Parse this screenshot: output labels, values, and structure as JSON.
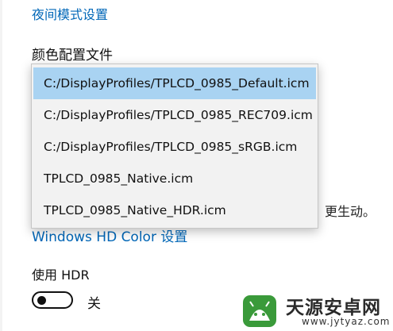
{
  "links": {
    "night_mode": "夜间模式设置",
    "hd_color": "Windows HD Color 设置"
  },
  "color_profile": {
    "label": "颜色配置文件",
    "options": [
      "C:/DisplayProfiles/TPLCD_0985_Default.icm",
      "C:/DisplayProfiles/TPLCD_0985_REC709.icm",
      "C:/DisplayProfiles/TPLCD_0985_sRGB.icm",
      "TPLCD_0985_Native.icm",
      "TPLCD_0985_Native_HDR.icm"
    ],
    "selected_index": 0
  },
  "partial_text": "、更生动。",
  "hdr": {
    "label": "使用 HDR",
    "state_label": "关",
    "on": false
  },
  "watermark": {
    "title": "天源安卓网",
    "url": "www.jytyaz.com"
  },
  "colors": {
    "link": "#0067b8",
    "selected_bg": "#a9d3f2",
    "dropdown_bg": "#f2f2f2",
    "watermark_green": "#3a9a3a"
  }
}
